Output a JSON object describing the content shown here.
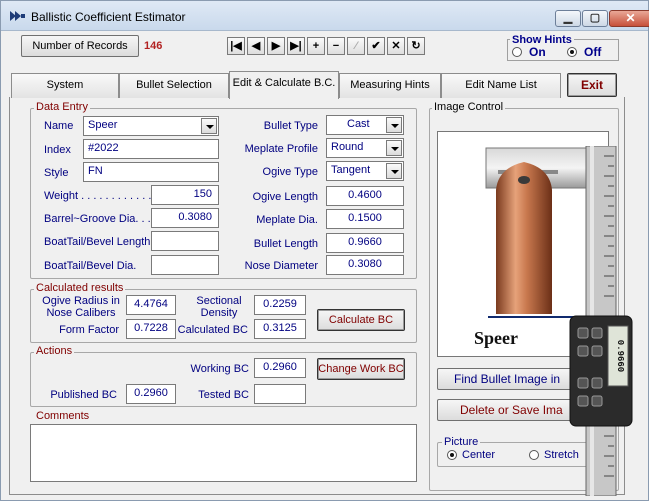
{
  "window": {
    "title": "Ballistic Coefficient Estimator",
    "close_glyph": "✕",
    "min_glyph": "▁",
    "max_glyph": "▢"
  },
  "toolbar": {
    "records_button": "Number of Records",
    "record_count": "146",
    "nav": [
      "|◀",
      "◀",
      "▶",
      "▶|",
      "+",
      "−",
      "⁄",
      "✔",
      "✕",
      "↻"
    ]
  },
  "hints": {
    "title": "Show Hints",
    "on": "On",
    "off": "Off",
    "selected": "Off"
  },
  "tabs": [
    {
      "label": "System"
    },
    {
      "label": "Bullet Selection"
    },
    {
      "label": "Edit & Calculate B.C."
    },
    {
      "label": "Measuring Hints"
    },
    {
      "label": "Edit Name List"
    },
    {
      "label": "Exit"
    }
  ],
  "data_entry": {
    "title": "Data Entry",
    "name_label": "Name",
    "name_value": "Speer",
    "index_label": "Index",
    "index_value": "#2022",
    "style_label": "Style",
    "style_value": "FN",
    "weight_label": "Weight . . . . . . . . . . . .",
    "weight_value": "150",
    "barrel_label": "Barrel~Groove Dia. . . .",
    "barrel_value": "0.3080",
    "boattail_len_label": "BoatTail/Bevel Length",
    "boattail_len_value": "",
    "boattail_dia_label": "BoatTail/Bevel Dia.",
    "boattail_dia_value": "",
    "bullet_type_label": "Bullet Type",
    "bullet_type_value": "Cast",
    "meplate_profile_label": "Meplate Profile",
    "meplate_profile_value": "Round",
    "ogive_type_label": "Ogive Type",
    "ogive_type_value": "Tangent",
    "ogive_length_label": "Ogive Length",
    "ogive_length_value": "0.4600",
    "meplate_dia_label": "Meplate Dia.",
    "meplate_dia_value": "0.1500",
    "bullet_length_label": "Bullet Length",
    "bullet_length_value": "0.9660",
    "nose_dia_label": "Nose Diameter",
    "nose_dia_value": "0.3080"
  },
  "calculated": {
    "title": "Calculated results",
    "ogive_radius_label": "Ogive Radius in\nNose Calibers",
    "ogive_radius_value": "4.4764",
    "sectional_label": "Sectional\nDensity",
    "sectional_value": "0.2259",
    "form_factor_label": "Form Factor",
    "form_factor_value": "0.7228",
    "calc_bc_label": "Calculated BC",
    "calc_bc_value": "0.3125",
    "calc_button": "Calculate BC"
  },
  "actions": {
    "title": "Actions",
    "working_bc_label": "Working BC",
    "working_bc_value": "0.2960",
    "change_button": "Change Work BC",
    "published_bc_label": "Published BC",
    "published_bc_value": "0.2960",
    "tested_bc_label": "Tested BC",
    "tested_bc_value": ""
  },
  "comments": {
    "title": "Comments",
    "value": ""
  },
  "image_control": {
    "title": "Image Control",
    "image_caption": "Speer",
    "caliper_reading": "0.9660",
    "find_button": "Find Bullet Image in",
    "delete_button": "Delete or Save Ima",
    "picture_label": "Picture",
    "center_label": "Center",
    "stretch_label": "Stretch",
    "selected": "Center"
  },
  "colors": {
    "label_blue": "#000080",
    "group_title": "#800000",
    "count_red": "#b22222",
    "bullet_copper": "#c8784e"
  }
}
